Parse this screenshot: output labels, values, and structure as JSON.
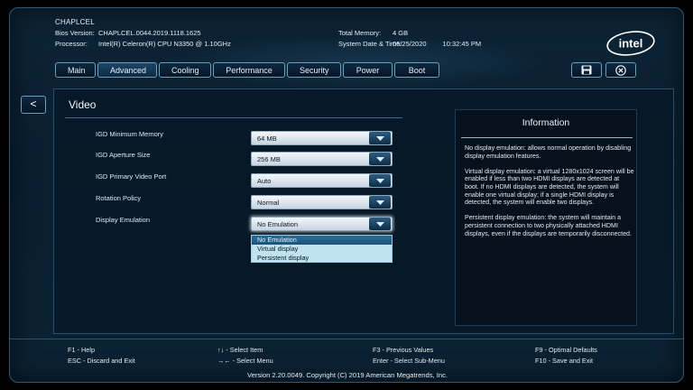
{
  "header": {
    "product": "CHAPLCEL",
    "bios_label": "Bios Version:",
    "bios_value": "CHAPLCEL.0044.2019.1118.1625",
    "processor_label": "Processor:",
    "processor_value": "Intel(R) Celeron(R) CPU N3350 @ 1.10GHz",
    "memory_label": "Total Memory:",
    "memory_value": "4 GB",
    "datetime_label": "System Date & Time:",
    "date_value": "06/25/2020",
    "time_value": "10:32:45 PM",
    "logo_text": "intel"
  },
  "tabs": [
    {
      "label": "Main"
    },
    {
      "label": "Advanced",
      "active": true
    },
    {
      "label": "Cooling"
    },
    {
      "label": "Performance"
    },
    {
      "label": "Security"
    },
    {
      "label": "Power"
    },
    {
      "label": "Boot"
    }
  ],
  "toolbar": {
    "save_icon": "save-icon",
    "exit_icon": "close-circle-icon"
  },
  "back": {
    "label": "<"
  },
  "section": {
    "title": "Video"
  },
  "settings": [
    {
      "label": "IGD Minimum Memory",
      "value": "64 MB"
    },
    {
      "label": "IGD Aperture Size",
      "value": "256 MB"
    },
    {
      "label": "IGD Primary Video Port",
      "value": "Auto"
    },
    {
      "label": "Rotation Policy",
      "value": "Normal"
    },
    {
      "label": "Display Emulation",
      "value": "No Emulation"
    }
  ],
  "dropdown": {
    "options": [
      "No Emulation",
      "Virtual display",
      "Persistent display"
    ],
    "selected_index": 0
  },
  "info": {
    "title": "Information",
    "paragraphs": [
      "No display emulation: allows normal operation by disabling display emulation features.",
      "Virtual display emulation: a virtual 1280x1024 screen will be enabled if less than two HDMI displays are detected at boot. If no HDMI displays are detected, the system will enable one virtual display; if a single HDMI display is detected, the system will enable two displays.",
      "Persistent display emulation: the system will maintain a persistent connection to two physically attached HDMI displays, even if the displays are temporarily disconnected."
    ]
  },
  "footer": {
    "f1": "F1 - Help",
    "esc": "ESC - Discard and Exit",
    "select_item": "↑↓ - Select Item",
    "select_menu": "→← - Select Menu",
    "f3": "F3 - Previous Values",
    "enter": "Enter - Select Sub-Menu",
    "f9": "F9 - Optimal Defaults",
    "f10": "F10 - Save and Exit",
    "version": "Version 2.20.0049. Copyright (C) 2019 American Megatrends, Inc."
  },
  "colors": {
    "accent": "#6b9dbd",
    "background": "#0b2233",
    "dropdown_bg": "#bfe3f1",
    "selected_option": "#1b537a"
  }
}
